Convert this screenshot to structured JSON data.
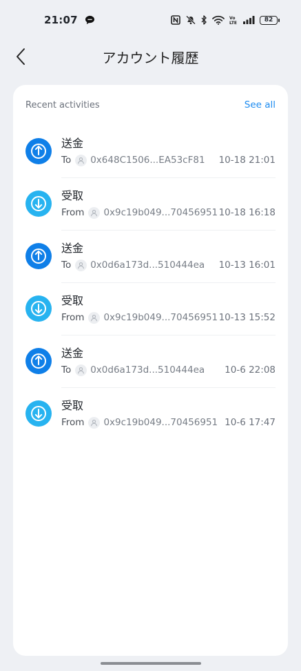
{
  "status_bar": {
    "time": "21:07",
    "battery": "82",
    "icons": [
      "chat-bubble-icon",
      "nfc-icon",
      "mute-icon",
      "bluetooth-icon",
      "wifi-icon",
      "volte-icon",
      "signal-icon",
      "battery-icon"
    ]
  },
  "header": {
    "title": "アカウント履歴",
    "back_icon": "chevron-left-icon"
  },
  "activities": {
    "title": "Recent activities",
    "see_all": "See all",
    "items": [
      {
        "kind": "send",
        "type": "送金",
        "dir": "To",
        "address": "0x648C1506...EA53cF81",
        "time": "10-18 21:01"
      },
      {
        "kind": "receive",
        "type": "受取",
        "dir": "From",
        "address": "0x9c19b049...70456951",
        "time": "10-18 16:18"
      },
      {
        "kind": "send",
        "type": "送金",
        "dir": "To",
        "address": "0x0d6a173d...510444ea",
        "time": "10-13 16:01"
      },
      {
        "kind": "receive",
        "type": "受取",
        "dir": "From",
        "address": "0x9c19b049...70456951",
        "time": "10-13 15:52"
      },
      {
        "kind": "send",
        "type": "送金",
        "dir": "To",
        "address": "0x0d6a173d...510444ea",
        "time": "10-6 22:08"
      },
      {
        "kind": "receive",
        "type": "受取",
        "dir": "From",
        "address": "0x9c19b049...70456951",
        "time": "10-6 17:47"
      }
    ]
  },
  "colors": {
    "send": "#0f7fe8",
    "receive": "#27b3f0",
    "link": "#1c8bf0",
    "background": "#eef0f4"
  }
}
